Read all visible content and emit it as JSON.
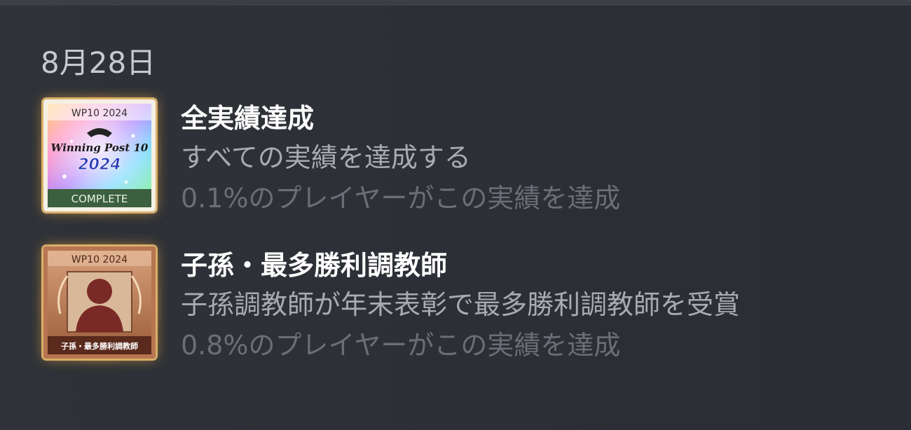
{
  "date": "8月28日",
  "achievements": [
    {
      "title": "全実績達成",
      "description": "すべての実績を達成する",
      "rate": "0.1%のプレイヤーがこの実績を達成",
      "icon": {
        "name": "complete-badge-icon",
        "top_text": "WP10 2024",
        "logo_text": "Winning Post 10",
        "year_text": "2024",
        "bottom_text": "COMPLETE"
      }
    },
    {
      "title": "子孫・最多勝利調教師",
      "description": "子孫調教師が年末表彰で最多勝利調教師を受賞",
      "rate": "0.8%のプレイヤーがこの実績を達成",
      "icon": {
        "name": "trainer-award-badge-icon",
        "top_text": "WP10 2024",
        "bottom_text": "子孫・最多勝利調教師"
      }
    }
  ],
  "colors": {
    "background": "#2c2f35",
    "title": "#ffffff",
    "description": "#a7abb2",
    "rate": "#6a6e76",
    "glow": "#ffb446"
  }
}
